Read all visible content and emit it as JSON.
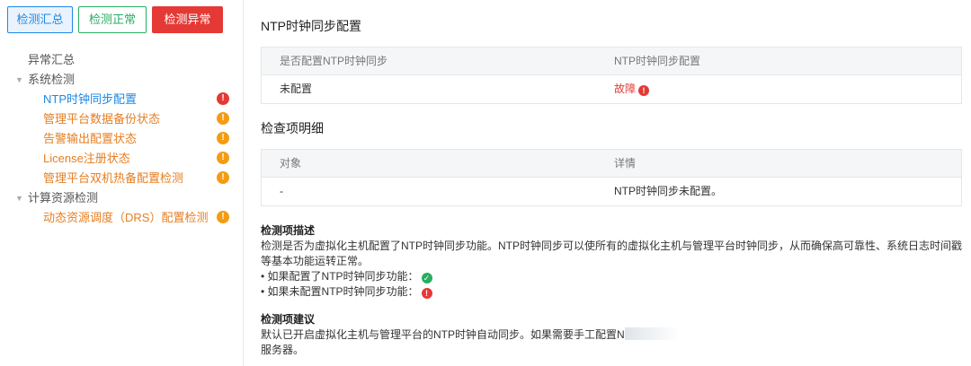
{
  "filters": {
    "all": "检测汇总",
    "normal": "检测正常",
    "abnormal": "检测异常"
  },
  "tree": {
    "root": "异常汇总",
    "groups": [
      {
        "label": "系统检测",
        "items": [
          "NTP时钟同步配置",
          "管理平台数据备份状态",
          "告警输出配置状态",
          "License注册状态",
          "管理平台双机热备配置检测"
        ]
      },
      {
        "label": "计算资源检测",
        "items": [
          "动态资源调度（DRS）配置检测"
        ]
      }
    ],
    "active_item": "NTP时钟同步配置"
  },
  "main": {
    "title": "NTP时钟同步配置",
    "config_table": {
      "headers": [
        "是否配置NTP时钟同步",
        "NTP时钟同步配置"
      ],
      "rows": [
        [
          "未配置",
          "故障"
        ]
      ]
    },
    "detail_title": "检查项明细",
    "detail_table": {
      "headers": [
        "对象",
        "详情"
      ],
      "rows": [
        [
          "-",
          "NTP时钟同步未配置。"
        ]
      ]
    },
    "description": {
      "heading": "检测项描述",
      "text": "检测是否为虚拟化主机配置了NTP时钟同步功能。NTP时钟同步可以使所有的虚拟化主机与管理平台时钟同步，从而确保高可靠性、系统日志时间戳等基本功能运转正常。",
      "bullet_ok": "• 如果配置了NTP时钟同步功能：",
      "bullet_bad": "• 如果未配置NTP时钟同步功能："
    },
    "suggestion": {
      "heading": "检测项建议",
      "text": "默认已开启虚拟化主机与管理平台的NTP时钟自动同步。如果需要手工配置N",
      "text2": "服务器。"
    }
  },
  "colors": {
    "accent": "#1e88e5",
    "ok": "#27ae60",
    "error": "#e53935",
    "warning": "#f39c12"
  }
}
